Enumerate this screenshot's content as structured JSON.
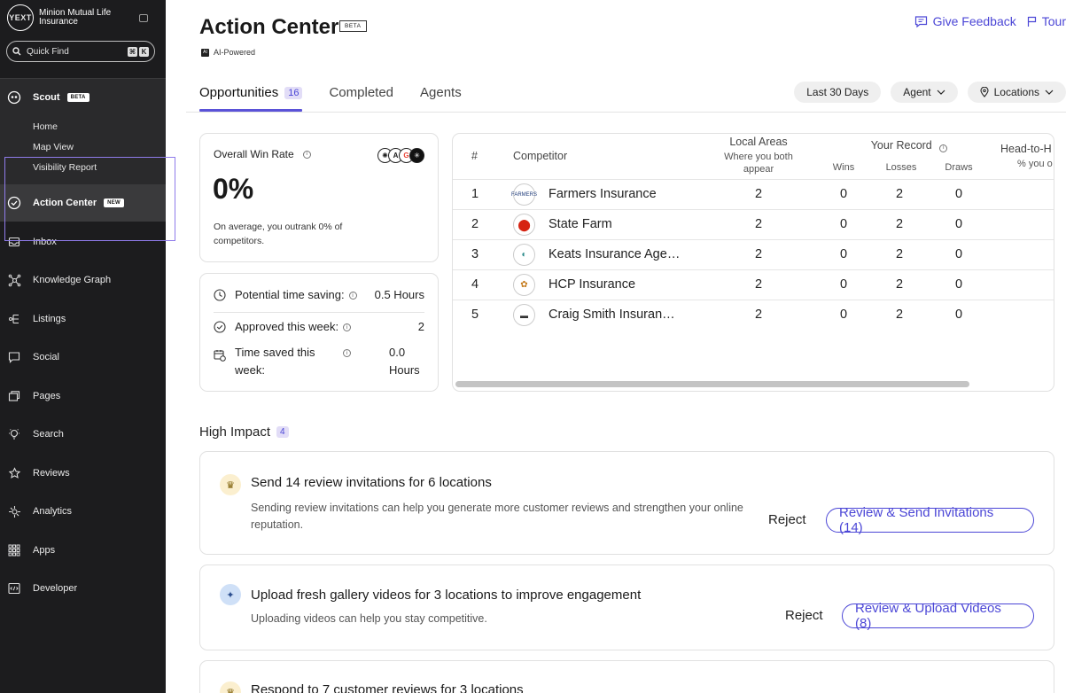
{
  "sidebar": {
    "brand_logo": "YEXT",
    "brand_name": "Minion Mutual Life Insurance",
    "quickfind_label": "Quick Find",
    "quickfind_keys": [
      "⌘",
      "K"
    ],
    "scout": {
      "label": "Scout",
      "badge": "BETA"
    },
    "scout_sub": [
      "Home",
      "Map View",
      "Visibility Report"
    ],
    "action_center": {
      "label": "Action Center",
      "badge": "NEW"
    },
    "items": [
      {
        "label": "Inbox",
        "icon": "inbox-icon"
      },
      {
        "label": "Knowledge Graph",
        "icon": "knowledge-graph-icon"
      },
      {
        "label": "Listings",
        "icon": "listings-icon"
      },
      {
        "label": "Social",
        "icon": "social-icon"
      },
      {
        "label": "Pages",
        "icon": "pages-icon"
      },
      {
        "label": "Search",
        "icon": "search-bulb-icon"
      },
      {
        "label": "Reviews",
        "icon": "reviews-icon"
      },
      {
        "label": "Analytics",
        "icon": "analytics-icon"
      },
      {
        "label": "Apps",
        "icon": "apps-icon"
      },
      {
        "label": "Developer",
        "icon": "developer-icon"
      }
    ]
  },
  "header": {
    "title": "Action Center",
    "beta": "BETA",
    "ai_powered": "AI-Powered",
    "ai_icon": "AI",
    "feedback": "Give Feedback",
    "tour": "Tour"
  },
  "tabs": [
    {
      "label": "Opportunities",
      "count": "16"
    },
    {
      "label": "Completed"
    },
    {
      "label": "Agents"
    }
  ],
  "filters": {
    "period": "Last 30 Days",
    "agent": "Agent",
    "locations": "Locations"
  },
  "win_rate": {
    "label": "Overall Win Rate",
    "value": "0%",
    "desc": "On average, you outrank 0% of competitors.",
    "ai_logo_letters": [
      "",
      "A",
      "G",
      ""
    ]
  },
  "stats": {
    "time_saving_label": "Potential time saving:",
    "time_saving_value": "0.5 Hours",
    "approved_label": "Approved this week:",
    "approved_value": "2",
    "time_saved_label": "Time saved this week:",
    "time_saved_value": "0.0 Hours"
  },
  "competitors": {
    "headers": {
      "num": "#",
      "competitor": "Competitor",
      "local_areas": "Local Areas",
      "local_sub": "Where you both appear",
      "record": "Your Record",
      "wins": "Wins",
      "losses": "Losses",
      "draws": "Draws",
      "h2h": "Head-to-H",
      "h2h_sub": "% you o"
    },
    "rows": [
      {
        "num": "1",
        "name": "Farmers Insurance",
        "areas": "2",
        "wins": "0",
        "losses": "2",
        "draws": "0"
      },
      {
        "num": "2",
        "name": "State Farm",
        "areas": "2",
        "wins": "0",
        "losses": "2",
        "draws": "0"
      },
      {
        "num": "3",
        "name": "Keats Insurance Age…",
        "areas": "2",
        "wins": "0",
        "losses": "2",
        "draws": "0"
      },
      {
        "num": "4",
        "name": "HCP Insurance",
        "areas": "2",
        "wins": "0",
        "losses": "2",
        "draws": "0"
      },
      {
        "num": "5",
        "name": "Craig Smith Insuran…",
        "areas": "2",
        "wins": "0",
        "losses": "2",
        "draws": "0"
      }
    ]
  },
  "high_impact": {
    "title": "High Impact",
    "count": "4",
    "cards": [
      {
        "title": "Send 14 review invitations for 6 locations",
        "desc": "Sending review invitations can help you generate more customer reviews and strengthen your online reputation.",
        "reject": "Reject",
        "action": "Review & Send Invitations (14)"
      },
      {
        "title": "Upload fresh gallery videos for 3 locations to improve engagement",
        "desc": "Uploading videos can help you stay competitive.",
        "reject": "Reject",
        "action": "Review & Upload Videos (8)"
      },
      {
        "title": "Respond to 7 customer reviews for 3 locations"
      }
    ]
  },
  "colors": {
    "accent": "#4b46d6",
    "sidebar_bg": "#1c1c1e",
    "highlight": "#8f7bea"
  }
}
